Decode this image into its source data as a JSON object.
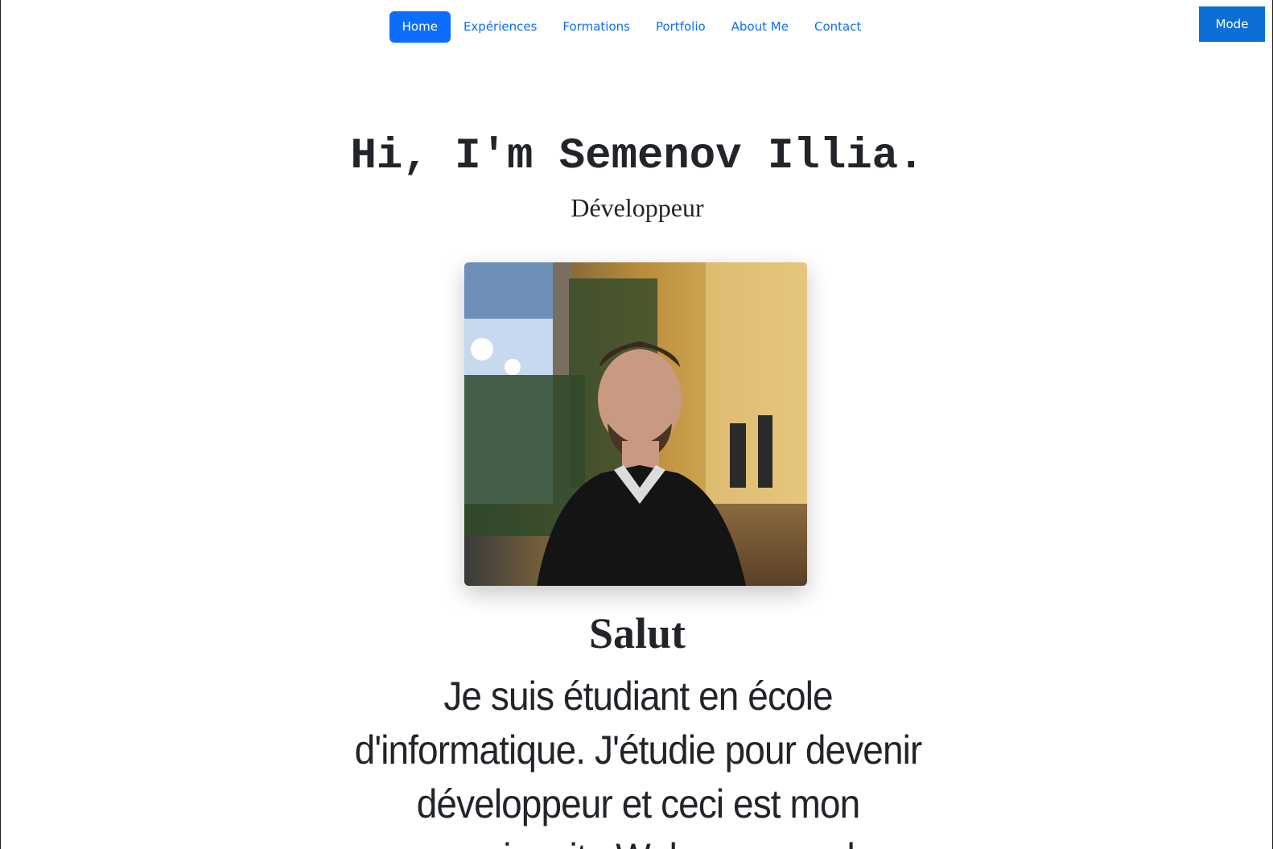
{
  "nav": {
    "items": [
      {
        "label": "Home",
        "active": true
      },
      {
        "label": "Expériences",
        "active": false
      },
      {
        "label": "Formations",
        "active": false
      },
      {
        "label": "Portfolio",
        "active": false
      },
      {
        "label": "About Me",
        "active": false
      },
      {
        "label": "Contact",
        "active": false
      }
    ]
  },
  "mode_button": {
    "label": "Mode"
  },
  "hero": {
    "title": "Hi, I'm Semenov Illia.",
    "subtitle": "Développeur"
  },
  "about": {
    "heading": "Salut",
    "text": "Je suis étudiant en école d'informatique. J'étudie pour devenir développeur et ceci est mon premier site Web personnel"
  },
  "colors": {
    "accent": "#0d6efd",
    "text": "#212529",
    "background": "#ffffff"
  }
}
